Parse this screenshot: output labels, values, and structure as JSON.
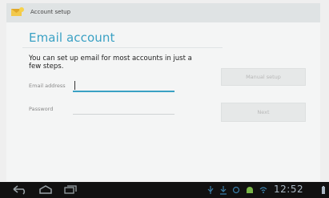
{
  "window": {
    "title": "Account setup"
  },
  "page": {
    "heading": "Email account",
    "intro": "You can set up email for most accounts in just a few steps."
  },
  "form": {
    "email_label": "Email address",
    "email_value": "",
    "password_label": "Password",
    "password_value": ""
  },
  "buttons": {
    "manual_setup": "Manual setup",
    "next": "Next"
  },
  "status": {
    "clock": "12:52"
  },
  "colors": {
    "accent": "#3aa1c4",
    "navbar": "#111111"
  },
  "icons": [
    "mail-app-icon",
    "back-icon",
    "home-icon",
    "recent-apps-icon",
    "usb-icon",
    "download-icon",
    "settings-notify-icon",
    "android-icon",
    "wifi-icon",
    "battery-icon"
  ]
}
